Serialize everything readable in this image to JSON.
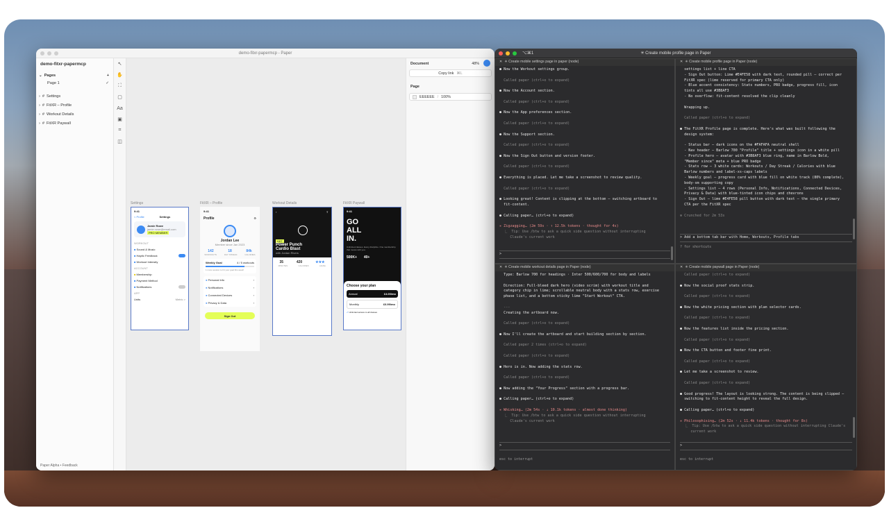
{
  "paper": {
    "title": "demo-fitxr-papermcp - Paper",
    "project": "demo-fitxr-papermcp",
    "pages_header": "Pages",
    "add_page": "+",
    "page1": "Page 1",
    "check": "✓",
    "layers": [
      "Settings",
      "FitXR – Profile",
      "Workout Details",
      "FitXR Paywall"
    ],
    "footer": "Paper Alpha  •  Feedback",
    "inspector": {
      "document": "Document",
      "zoom": "48%",
      "copy_link": "Copy link",
      "shortcut": "⌘L",
      "page": "Page",
      "bg": "EEEEEE",
      "bg_opacity": "100%"
    },
    "artboards": {
      "settings": {
        "label": "Settings",
        "title": "Settings",
        "back": "< Profile",
        "name": "Jamie Rowe",
        "email": "jamie.rowe@email.com",
        "badge": "PRO MEMBER",
        "sections": [
          "WORKOUT",
          "ACCOUNT",
          "APP"
        ],
        "rows": [
          "Sound & Music",
          "Haptic Feedback",
          "Workout Intensity",
          "Membership",
          "Payment Method",
          "Notifications",
          "Units"
        ],
        "units_value": "Metric >"
      },
      "profile": {
        "label": "FitXR – Profile",
        "title": "Profile",
        "name": "Jordan Lee",
        "since": "Member since Jan 2023",
        "stats": [
          "142",
          "18",
          "84k"
        ],
        "stat_labels": [
          "WORKOUTS",
          "DAY STREAK",
          "CALORIES"
        ],
        "goal": "Weekly Goal",
        "goal_val": "4 / 5 workouts",
        "goal_sub": "1 more session to hit your goal this week!",
        "rows": [
          "Personal Info",
          "Notifications",
          "Connected Devices",
          "Privacy & Data"
        ],
        "signout": "Sign Out"
      },
      "workout": {
        "label": "Workout Details",
        "chip": "HIIT",
        "title1": "Power Punch",
        "title2": "Cardio Blast",
        "coach": "with Jordan Rivers",
        "stats": [
          "35",
          "420",
          "★★★"
        ],
        "stat_labels": [
          "MINUTES",
          "CALORIES",
          "LEVEL"
        ]
      },
      "paywall": {
        "label": "FitXR Paywall",
        "hero1": "GO",
        "hero2": "ALL",
        "hero3": "IN.",
        "sub": "Unlimited classes. Every discipline. One membership that moves with you.",
        "stats": [
          "500K+",
          "40+"
        ],
        "choose": "Choose your plan",
        "annual": "Annual",
        "annual_price": "£4.00/mo",
        "monthly": "Monthly",
        "monthly_price": "£6.99/mo",
        "feature": "Unlimited access to all classes"
      }
    }
  },
  "terminal": {
    "title": "✳ Create mobile profile page in Paper",
    "tab_shortcut": "⌥⌘1",
    "panes": [
      {
        "header": "✳ Create mobile settings page in paper (node)",
        "lines": [
          {
            "t": "● Now the Workout settings group.",
            "c": "bul"
          },
          {
            "t": "",
            "c": ""
          },
          {
            "t": "  Called paper (ctrl+o to expand)",
            "c": "dim"
          },
          {
            "t": "",
            "c": ""
          },
          {
            "t": "● Now the Account section.",
            "c": "bul"
          },
          {
            "t": "",
            "c": ""
          },
          {
            "t": "  Called paper (ctrl+o to expand)",
            "c": "dim"
          },
          {
            "t": "",
            "c": ""
          },
          {
            "t": "● Now the App preferences section.",
            "c": "bul"
          },
          {
            "t": "",
            "c": ""
          },
          {
            "t": "  Called paper (ctrl+o to expand)",
            "c": "dim"
          },
          {
            "t": "",
            "c": ""
          },
          {
            "t": "● Now the Support section.",
            "c": "bul"
          },
          {
            "t": "",
            "c": ""
          },
          {
            "t": "  Called paper (ctrl+o to expand)",
            "c": "dim"
          },
          {
            "t": "",
            "c": ""
          },
          {
            "t": "● Now the Sign Out button and version footer.",
            "c": "bul"
          },
          {
            "t": "",
            "c": ""
          },
          {
            "t": "  Called paper (ctrl+o to expand)",
            "c": "dim"
          },
          {
            "t": "",
            "c": ""
          },
          {
            "t": "● Everything is placed. Let me take a screenshot to review quality.",
            "c": "bul"
          },
          {
            "t": "",
            "c": ""
          },
          {
            "t": "  Called paper (ctrl+o to expand)",
            "c": "dim"
          },
          {
            "t": "",
            "c": ""
          },
          {
            "t": "● Looking great! Content is clipping at the bottom — switching artboard to",
            "c": "bul"
          },
          {
            "t": "  fit-content.",
            "c": "bul"
          },
          {
            "t": "",
            "c": ""
          },
          {
            "t": "● Calling paper… (ctrl+o to expand)",
            "c": "bul"
          },
          {
            "t": "",
            "c": ""
          },
          {
            "t": "✳ Zigzagging… (2m 59s · ↑ 12.5k tokens · thought for 4s)",
            "c": "pink"
          },
          {
            "t": "  ⎿  Tip: Use /btw to ask a quick side question without interrupting",
            "c": "dim"
          },
          {
            "t": "     Claude's current work",
            "c": "dim"
          }
        ],
        "prompt": ">"
      },
      {
        "header": "✳ Create mobile profile page in Paper (node)",
        "lines": [
          {
            "t": "  settings list + line CTA",
            "c": "bul"
          },
          {
            "t": "  - Sign Out button: Lime #E4FE58 with dark text, rounded pill — correct per",
            "c": "bul"
          },
          {
            "t": "  FitXR spec (lime reserved for primary CTA only)",
            "c": "bul"
          },
          {
            "t": "  - Blue accent consistency: Stats numbers, PRO badge, progress fill, icon",
            "c": "bul"
          },
          {
            "t": "  tints all use #3B8AF3",
            "c": "bul"
          },
          {
            "t": "  - No overflow: fit-content resolved the clip cleanly",
            "c": "bul"
          },
          {
            "t": "",
            "c": ""
          },
          {
            "t": "  Wrapping up.",
            "c": "bul"
          },
          {
            "t": "",
            "c": ""
          },
          {
            "t": "  Called paper (ctrl+o to expand)",
            "c": "dim"
          },
          {
            "t": "",
            "c": ""
          },
          {
            "t": "● The FitXR Profile page is complete. Here's what was built following the",
            "c": "bul"
          },
          {
            "t": "  design system:",
            "c": "bul"
          },
          {
            "t": "",
            "c": ""
          },
          {
            "t": "  - Status bar — dark icons on the #FAFAFA neutral shell",
            "c": "bul"
          },
          {
            "t": "  - Nav header — Barlow 700 \"Profile\" title + settings icon in a white pill",
            "c": "bul"
          },
          {
            "t": "  - Profile hero — avatar with #3B8AF3 blue ring, name in Barlow Bold,",
            "c": "bul"
          },
          {
            "t": "  \"Member since\" meta + blue PRO badge",
            "c": "bul"
          },
          {
            "t": "  - Stats row — 3 white cards: Workouts / Day Streak / Calories with blue",
            "c": "bul"
          },
          {
            "t": "  Barlow numbers and label-xs-caps labels",
            "c": "bul"
          },
          {
            "t": "  - Weekly goal — progress card with blue fill on white track (80% complete),",
            "c": "bul"
          },
          {
            "t": "  body-sm supporting copy",
            "c": "bul"
          },
          {
            "t": "  - Settings list — 4 rows (Personal Info, Notifications, Connected Devices,",
            "c": "bul"
          },
          {
            "t": "  Privacy & Data) with blue-tinted icon chips and chevrons",
            "c": "bul"
          },
          {
            "t": "  - Sign Out — lime #E4FE58 pill button with dark text — the single primary",
            "c": "bul"
          },
          {
            "t": "  CTA per the FitXR spec",
            "c": "bul"
          },
          {
            "t": "",
            "c": ""
          },
          {
            "t": "✻ Crunched for 2m 53s",
            "c": "dim"
          }
        ],
        "input": "> Add a bottom tab bar with Home, Workouts, Profile tabs",
        "hint": "? for shortcuts"
      },
      {
        "header": "✳ Create mobile workout details page in Paper (node)",
        "lines": [
          {
            "t": "  Type: Barlow 700 for headings · Inter 500/600/700 for body and labels",
            "c": "bul"
          },
          {
            "t": "",
            "c": ""
          },
          {
            "t": "  Direction: Full-bleed dark hero (video scrim) with workout title and",
            "c": "bul"
          },
          {
            "t": "  category chip in lime; scrollable neutral body with a stats row, exercise",
            "c": "bul"
          },
          {
            "t": "  phase list, and a bottom sticky lime \"Start Workout\" CTA.",
            "c": "bul"
          },
          {
            "t": "",
            "c": ""
          },
          {
            "t": "  ---",
            "c": "dim"
          },
          {
            "t": "  Creating the artboard now.",
            "c": "bul"
          },
          {
            "t": "",
            "c": ""
          },
          {
            "t": "  Called paper (ctrl+o to expand)",
            "c": "dim"
          },
          {
            "t": "",
            "c": ""
          },
          {
            "t": "● Now I'll create the artboard and start building section by section.",
            "c": "bul"
          },
          {
            "t": "",
            "c": ""
          },
          {
            "t": "  Called paper 2 times (ctrl+o to expand)",
            "c": "dim"
          },
          {
            "t": "",
            "c": ""
          },
          {
            "t": "  Called paper (ctrl+o to expand)",
            "c": "dim"
          },
          {
            "t": "",
            "c": ""
          },
          {
            "t": "● Hero is in. Now adding the stats row.",
            "c": "bul"
          },
          {
            "t": "",
            "c": ""
          },
          {
            "t": "  Called paper (ctrl+o to expand)",
            "c": "dim"
          },
          {
            "t": "",
            "c": ""
          },
          {
            "t": "● Now adding the \"Your Progress\" section with a progress bar.",
            "c": "bul"
          },
          {
            "t": "",
            "c": ""
          },
          {
            "t": "● Calling paper… (ctrl+o to expand)",
            "c": "bul"
          },
          {
            "t": "",
            "c": ""
          },
          {
            "t": "✳ Whisking… (2m 54s · ↓ 10.1k tokens · almost done thinking)",
            "c": "pink"
          },
          {
            "t": "  ⎿  Tip: Use /btw to ask a quick side question without interrupting",
            "c": "dim"
          },
          {
            "t": "     Claude's current work",
            "c": "dim"
          }
        ],
        "prompt": ">",
        "hint": "esc to interrupt"
      },
      {
        "header": "✳ Create mobile paywall page in Paper (node)",
        "lines": [
          {
            "t": "  Called paper (ctrl+o to expand)",
            "c": "dim"
          },
          {
            "t": "",
            "c": ""
          },
          {
            "t": "● Now the social proof stats strip.",
            "c": "bul"
          },
          {
            "t": "",
            "c": ""
          },
          {
            "t": "  Called paper (ctrl+o to expand)",
            "c": "dim"
          },
          {
            "t": "",
            "c": ""
          },
          {
            "t": "● Now the white pricing section with plan selector cards.",
            "c": "bul"
          },
          {
            "t": "",
            "c": ""
          },
          {
            "t": "  Called paper (ctrl+o to expand)",
            "c": "dim"
          },
          {
            "t": "",
            "c": ""
          },
          {
            "t": "● Now the features list inside the pricing section.",
            "c": "bul"
          },
          {
            "t": "",
            "c": ""
          },
          {
            "t": "  Called paper (ctrl+o to expand)",
            "c": "dim"
          },
          {
            "t": "",
            "c": ""
          },
          {
            "t": "● Now the CTA button and footer fine print.",
            "c": "bul"
          },
          {
            "t": "",
            "c": ""
          },
          {
            "t": "  Called paper (ctrl+o to expand)",
            "c": "dim"
          },
          {
            "t": "",
            "c": ""
          },
          {
            "t": "● Let me take a screenshot to review.",
            "c": "bul"
          },
          {
            "t": "",
            "c": ""
          },
          {
            "t": "  Called paper (ctrl+o to expand)",
            "c": "dim"
          },
          {
            "t": "",
            "c": ""
          },
          {
            "t": "● Good progress! The layout is looking strong. The content is being clipped —",
            "c": "bul"
          },
          {
            "t": "  switching to fit-content height to reveal the full design.",
            "c": "bul"
          },
          {
            "t": "",
            "c": ""
          },
          {
            "t": "● Calling paper… (ctrl+o to expand)",
            "c": "bul"
          },
          {
            "t": "",
            "c": ""
          },
          {
            "t": "✳ Philosophising… (2m 52s · ↓ 11.4k tokens · thought for 8s)",
            "c": "pink"
          },
          {
            "t": "  ⎿  Tip: Use /btw to ask a quick side question without interrupting Claude's",
            "c": "dim"
          },
          {
            "t": "     current work",
            "c": "dim"
          }
        ],
        "prompt": ">",
        "hint": "esc to interrupt"
      }
    ]
  },
  "colors": {
    "lime": "#E4FE58",
    "blue": "#3B8AF3",
    "shell": "#FAFAFA"
  }
}
